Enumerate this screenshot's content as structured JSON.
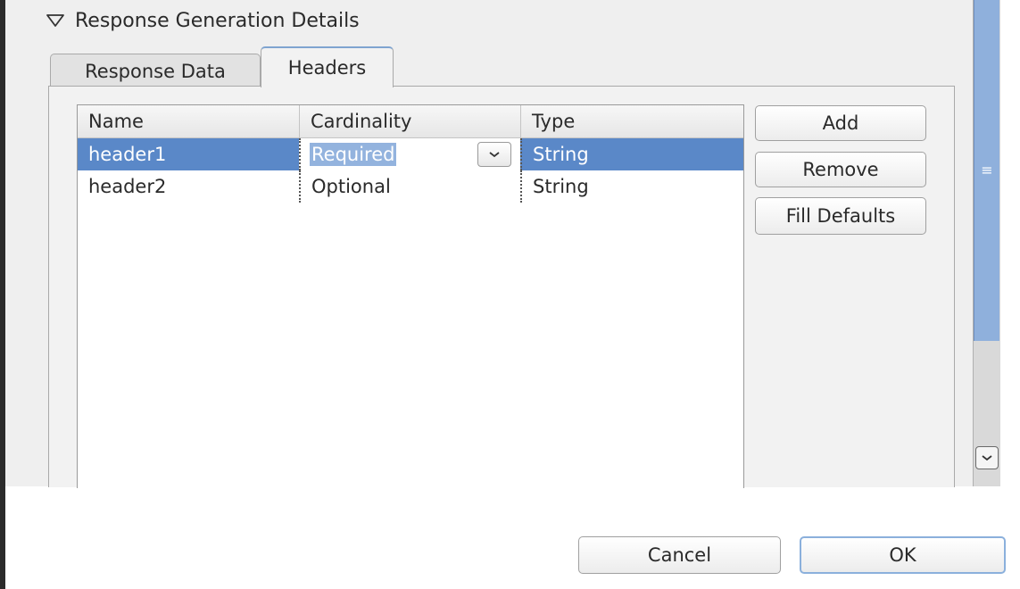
{
  "section": {
    "title": "Response Generation Details",
    "toggle_icon": "triangle-down-icon"
  },
  "tabs": [
    {
      "label": "Response Data",
      "active": false
    },
    {
      "label": "Headers",
      "active": true
    }
  ],
  "table": {
    "columns": [
      "Name",
      "Cardinality",
      "Type"
    ],
    "rows": [
      {
        "name": "header1",
        "cardinality": "Required",
        "type": "String",
        "selected": true
      },
      {
        "name": "header2",
        "cardinality": "Optional",
        "type": "String",
        "selected": false
      }
    ]
  },
  "side_buttons": {
    "add": "Add",
    "remove": "Remove",
    "fill_defaults": "Fill Defaults"
  },
  "dialog_buttons": {
    "cancel": "Cancel",
    "ok": "OK"
  },
  "colors": {
    "selection": "#5a88c8",
    "scroll_thumb": "#8fb0dc",
    "default_button_border": "#8bb0dc"
  }
}
